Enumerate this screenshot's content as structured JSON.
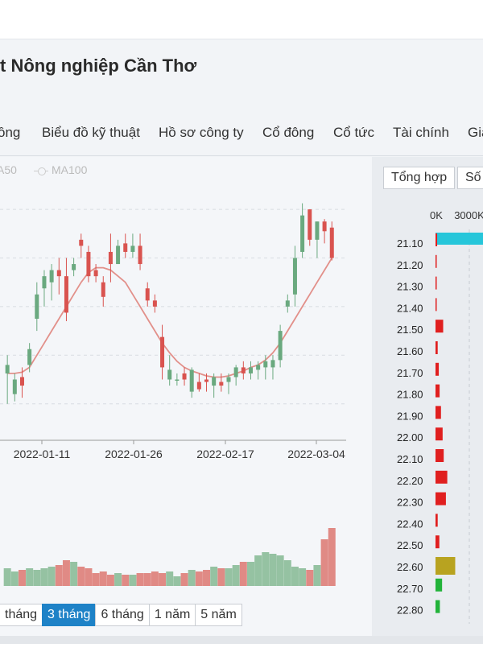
{
  "header": {
    "title": "t Nông nghiệp Cần Thơ",
    "tabs": [
      "ồng",
      "Biểu đồ kỹ thuật",
      "Hồ sơ công ty",
      "Cổ đông",
      "Cổ tức",
      "Tài chính",
      "Gia"
    ]
  },
  "legend": {
    "ma50": "A50",
    "ma100": "MA100"
  },
  "range_buttons": [
    "tháng",
    "3 tháng",
    "6 tháng",
    "1 năm",
    "5 năm"
  ],
  "active_range": "3 tháng",
  "volume_tabs": [
    "Tổng hợp",
    "Số"
  ],
  "colors": {
    "up": "#6aa97f",
    "down": "#d9534f",
    "ma": "#e2908a",
    "accent": "#1e82c7",
    "cyan": "#26c6da",
    "olive": "#b8a320",
    "green": "#22b33a"
  },
  "chart_data": [
    {
      "type": "line",
      "x_tick_labels": [
        "2022-01-11",
        "2022-01-26",
        "2022-02-17",
        "2022-03-04"
      ],
      "candles": [
        {
          "o": 21.55,
          "h": 21.7,
          "l": 21.3,
          "c": 21.62
        },
        {
          "o": 21.38,
          "h": 21.55,
          "l": 21.32,
          "c": 21.5
        },
        {
          "o": 21.52,
          "h": 21.6,
          "l": 21.35,
          "c": 21.45
        },
        {
          "o": 21.62,
          "h": 21.8,
          "l": 21.56,
          "c": 21.75
        },
        {
          "o": 22.0,
          "h": 22.3,
          "l": 21.9,
          "c": 22.2
        },
        {
          "o": 22.25,
          "h": 22.4,
          "l": 22.1,
          "c": 22.35
        },
        {
          "o": 22.3,
          "h": 22.45,
          "l": 22.15,
          "c": 22.4
        },
        {
          "o": 22.4,
          "h": 22.5,
          "l": 22.2,
          "c": 22.35
        },
        {
          "o": 22.35,
          "h": 22.5,
          "l": 21.98,
          "c": 22.05
        },
        {
          "o": 22.4,
          "h": 22.5,
          "l": 22.35,
          "c": 22.45
        },
        {
          "o": 22.65,
          "h": 22.7,
          "l": 22.5,
          "c": 22.6
        },
        {
          "o": 22.55,
          "h": 22.6,
          "l": 22.3,
          "c": 22.35
        },
        {
          "o": 22.4,
          "h": 22.45,
          "l": 22.3,
          "c": 22.35
        },
        {
          "o": 22.3,
          "h": 22.35,
          "l": 22.1,
          "c": 22.18
        },
        {
          "o": 22.55,
          "h": 22.7,
          "l": 22.3,
          "c": 22.45
        },
        {
          "o": 22.45,
          "h": 22.65,
          "l": 22.5,
          "c": 22.6
        },
        {
          "o": 22.62,
          "h": 22.7,
          "l": 22.5,
          "c": 22.55
        },
        {
          "o": 22.55,
          "h": 22.7,
          "l": 22.5,
          "c": 22.6
        },
        {
          "o": 22.6,
          "h": 22.7,
          "l": 22.4,
          "c": 22.45
        },
        {
          "o": 22.25,
          "h": 22.3,
          "l": 22.1,
          "c": 22.15
        },
        {
          "o": 22.15,
          "h": 22.2,
          "l": 22.05,
          "c": 22.1
        },
        {
          "o": 21.85,
          "h": 21.95,
          "l": 21.5,
          "c": 21.6
        },
        {
          "o": 21.5,
          "h": 21.7,
          "l": 21.45,
          "c": 21.58
        },
        {
          "o": 21.5,
          "h": 21.55,
          "l": 21.45,
          "c": 21.5
        },
        {
          "o": 21.55,
          "h": 21.6,
          "l": 21.45,
          "c": 21.5
        },
        {
          "o": 21.4,
          "h": 21.6,
          "l": 21.35,
          "c": 21.58
        },
        {
          "o": 21.48,
          "h": 21.55,
          "l": 21.4,
          "c": 21.42
        },
        {
          "o": 21.5,
          "h": 21.55,
          "l": 21.4,
          "c": 21.48
        },
        {
          "o": 21.45,
          "h": 21.55,
          "l": 21.35,
          "c": 21.52
        },
        {
          "o": 21.48,
          "h": 21.55,
          "l": 21.4,
          "c": 21.45
        },
        {
          "o": 21.48,
          "h": 21.55,
          "l": 21.38,
          "c": 21.52
        },
        {
          "o": 21.52,
          "h": 21.62,
          "l": 21.45,
          "c": 21.6
        },
        {
          "o": 21.6,
          "h": 21.65,
          "l": 21.5,
          "c": 21.55
        },
        {
          "o": 21.55,
          "h": 21.65,
          "l": 21.5,
          "c": 21.6
        },
        {
          "o": 21.58,
          "h": 21.65,
          "l": 21.5,
          "c": 21.62
        },
        {
          "o": 21.6,
          "h": 21.7,
          "l": 21.5,
          "c": 21.65
        },
        {
          "o": 21.6,
          "h": 21.7,
          "l": 21.5,
          "c": 21.66
        },
        {
          "o": 21.66,
          "h": 21.95,
          "l": 21.6,
          "c": 21.9
        },
        {
          "o": 22.1,
          "h": 22.2,
          "l": 22.05,
          "c": 22.15
        },
        {
          "o": 22.2,
          "h": 22.6,
          "l": 22.1,
          "c": 22.5
        },
        {
          "o": 22.55,
          "h": 22.95,
          "l": 22.5,
          "c": 22.85
        },
        {
          "o": 22.9,
          "h": 22.9,
          "l": 22.6,
          "c": 22.65
        },
        {
          "o": 22.65,
          "h": 22.8,
          "l": 22.5,
          "c": 22.8
        },
        {
          "o": 22.8,
          "h": 22.82,
          "l": 22.62,
          "c": 22.72
        },
        {
          "o": 22.75,
          "h": 22.8,
          "l": 22.48,
          "c": 22.5
        }
      ],
      "ma": [
        21.55,
        21.55,
        21.56,
        21.6,
        21.7,
        21.8,
        21.9,
        22.0,
        22.1,
        22.2,
        22.3,
        22.38,
        22.42,
        22.42,
        22.4,
        22.35,
        22.3,
        22.2,
        22.1,
        22.0,
        21.9,
        21.8,
        21.72,
        21.65,
        21.6,
        21.57,
        21.55,
        21.53,
        21.52,
        21.52,
        21.53,
        21.55,
        21.57,
        21.6,
        21.62,
        21.66,
        21.72,
        21.8,
        21.9,
        22.0,
        22.1,
        22.2,
        22.3,
        22.4,
        22.5
      ],
      "volume": [
        22,
        18,
        20,
        22,
        20,
        22,
        24,
        26,
        32,
        30,
        24,
        22,
        16,
        18,
        14,
        16,
        14,
        14,
        16,
        16,
        18,
        16,
        18,
        12,
        16,
        20,
        18,
        20,
        24,
        22,
        22,
        26,
        30,
        30,
        38,
        42,
        40,
        38,
        32,
        24,
        22,
        20,
        26,
        58,
        72
      ]
    },
    {
      "type": "bar",
      "title": "",
      "x_tick_labels": [
        "0K",
        "3000K"
      ],
      "categories": [
        "21.10",
        "21.20",
        "21.30",
        "21.40",
        "21.50",
        "21.60",
        "21.70",
        "21.80",
        "21.90",
        "22.00",
        "22.10",
        "22.20",
        "22.30",
        "22.40",
        "22.50",
        "22.60",
        "22.70",
        "22.80"
      ],
      "values": [
        60,
        40,
        30,
        30,
        280,
        80,
        120,
        150,
        200,
        260,
        300,
        430,
        380,
        80,
        140,
        720,
        240,
        160
      ],
      "top_bar": 3500
    }
  ]
}
